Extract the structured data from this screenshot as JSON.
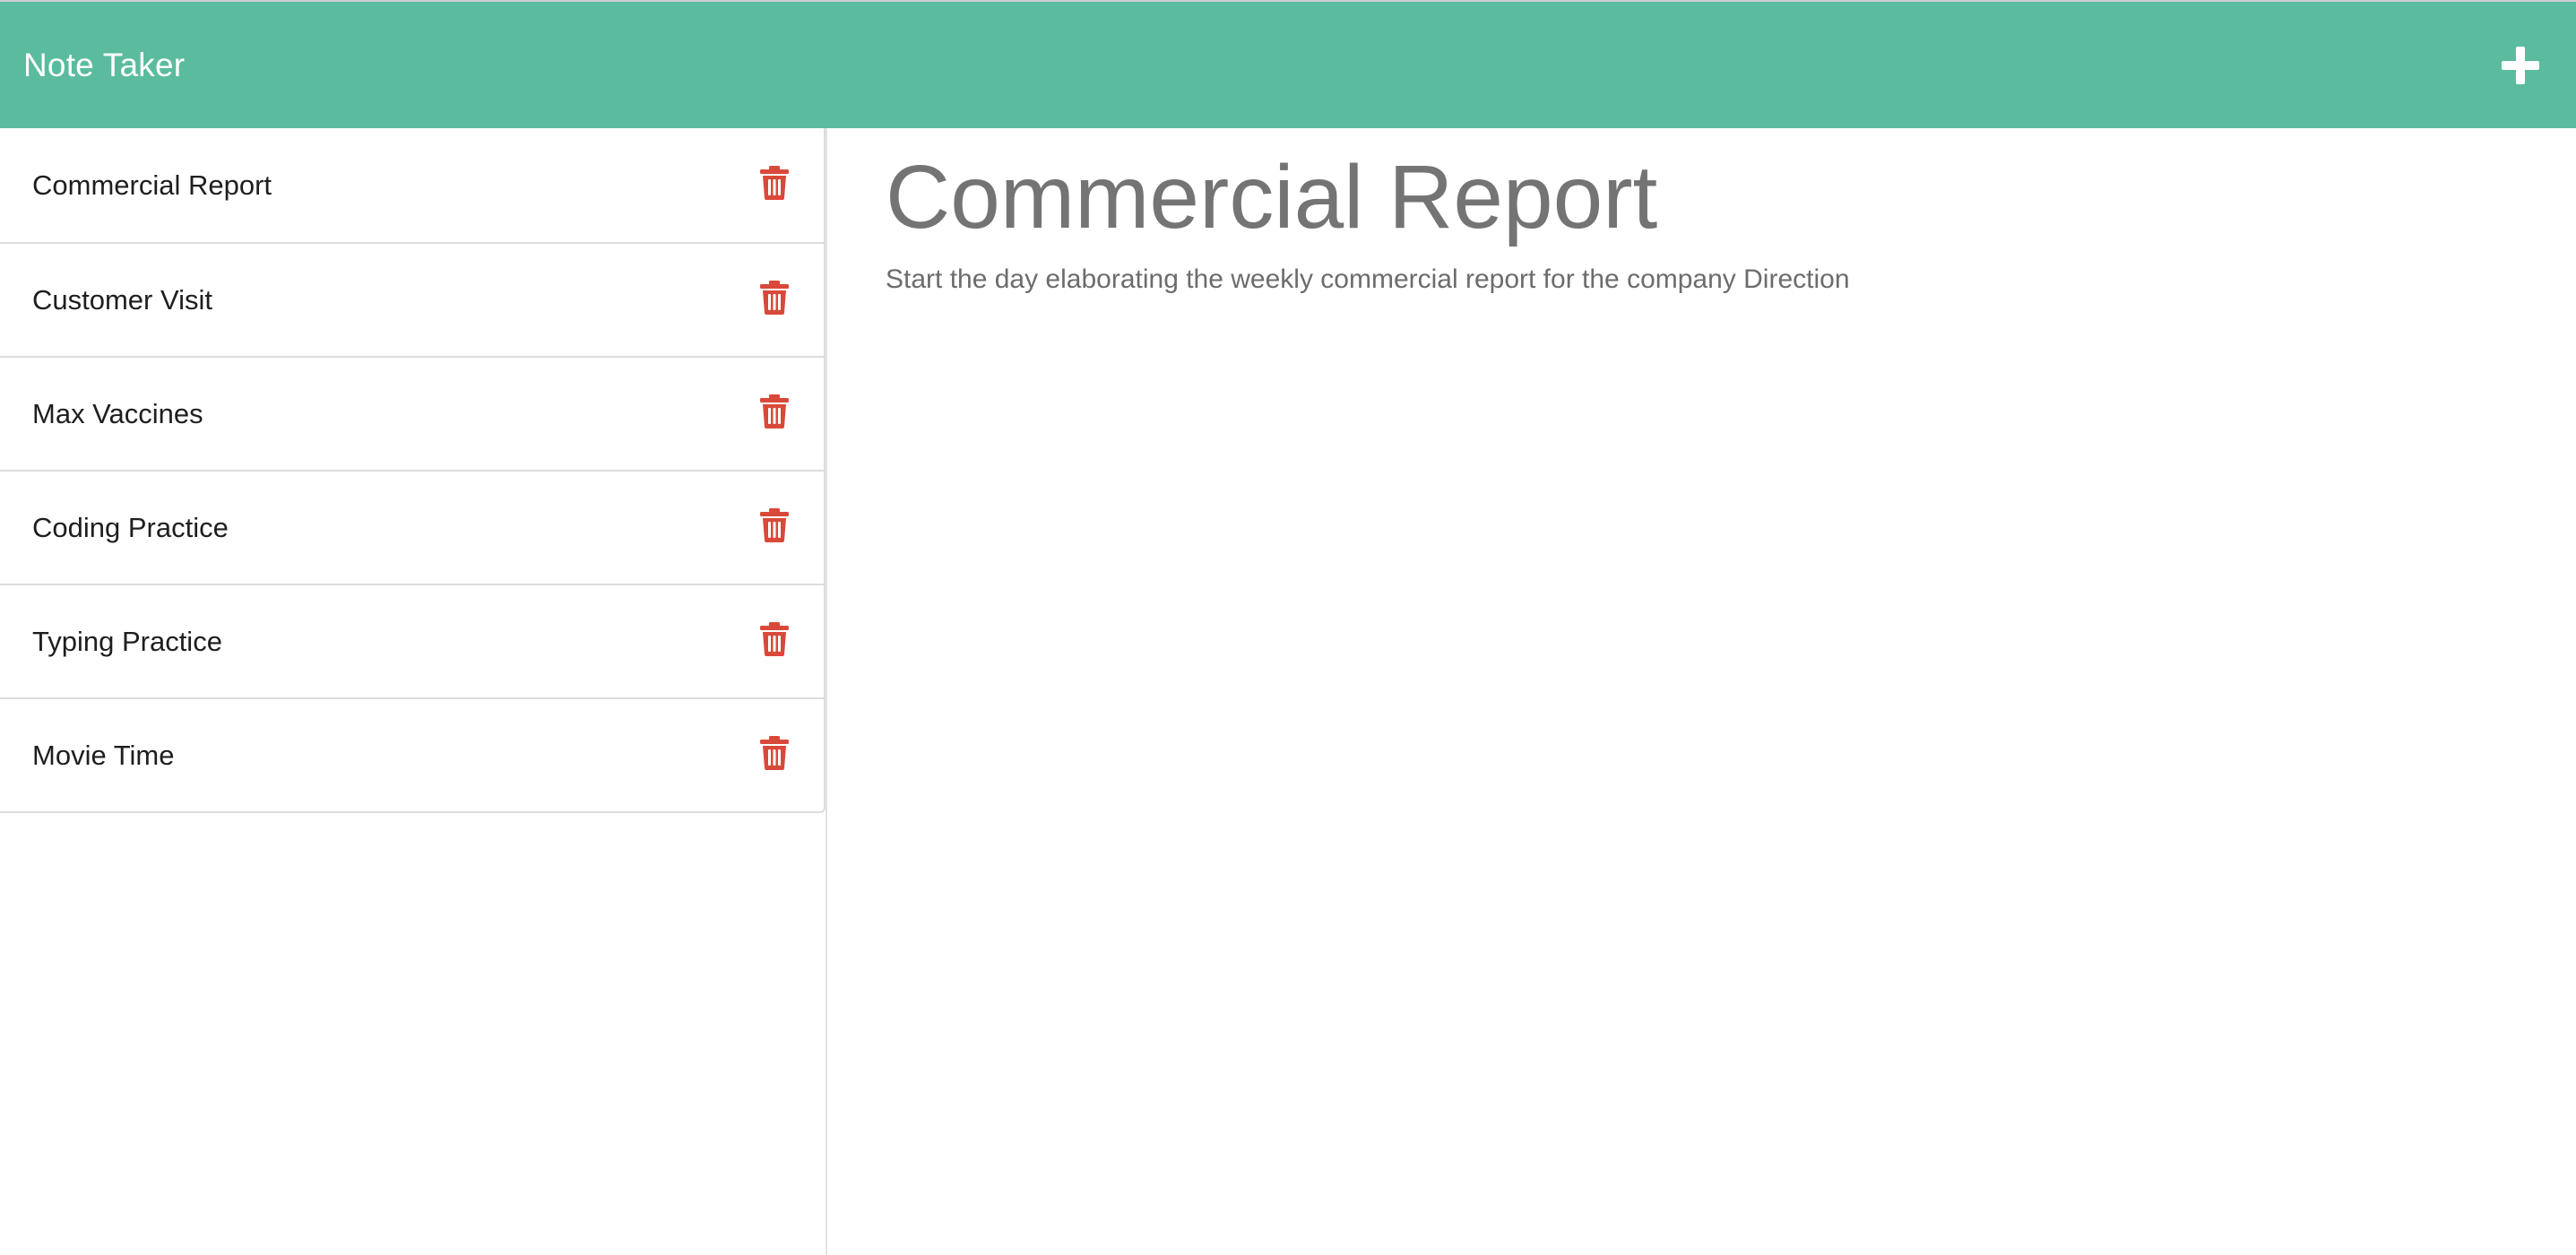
{
  "app": {
    "title": "Note Taker"
  },
  "header": {
    "add_icon": "plus-icon",
    "accent_color": "#5bbb9f"
  },
  "sidebar": {
    "delete_icon": "trash-icon",
    "delete_color": "#d9493a",
    "items": [
      {
        "label": "Commercial Report"
      },
      {
        "label": "Customer Visit"
      },
      {
        "label": "Max Vaccines"
      },
      {
        "label": "Coding Practice"
      },
      {
        "label": "Typing Practice"
      },
      {
        "label": "Movie Time"
      }
    ]
  },
  "main": {
    "title": "Commercial Report",
    "body": "Start the day elaborating the weekly commercial report for the company Direction"
  }
}
